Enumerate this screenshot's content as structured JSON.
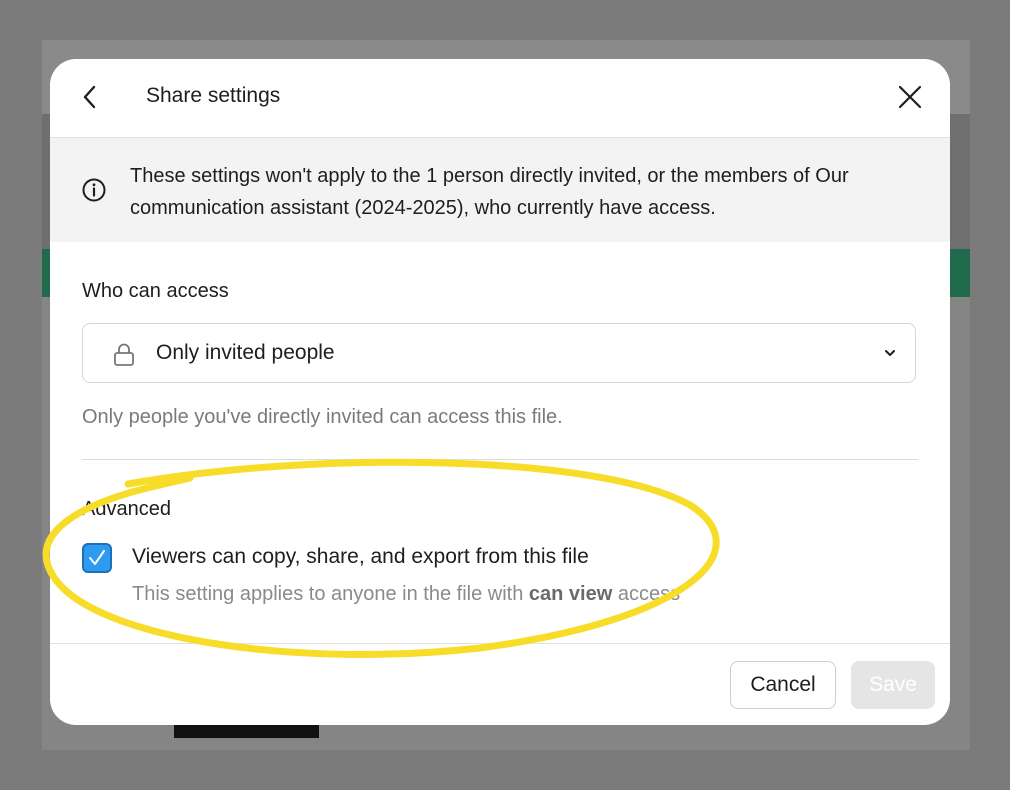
{
  "dialog": {
    "title": "Share settings",
    "info_text": "These settings won't apply to the 1 person directly invited, or the members of Our communication assistant (2024-2025), who currently have access.",
    "access": {
      "label": "Who can access",
      "selected": "Only invited people",
      "helper": "Only people you've directly invited can access this file."
    },
    "advanced": {
      "label": "Advanced",
      "checkbox_checked": true,
      "checkbox_label": "Viewers can copy, share, and export from this file",
      "desc_prefix": "This setting applies to anyone in the file with ",
      "desc_bold": "can view",
      "desc_suffix": " access"
    },
    "buttons": {
      "cancel": "Cancel",
      "save": "Save"
    }
  },
  "colors": {
    "checkbox": "#2d9bf0",
    "annotation": "#f7dd2a",
    "save_disabled": "#e5e5e5"
  },
  "icons": {
    "back": "chevron-left-icon",
    "close": "close-icon",
    "info": "info-icon",
    "lock": "lock-icon",
    "dropdown": "chevron-down-icon",
    "check": "check-icon"
  }
}
